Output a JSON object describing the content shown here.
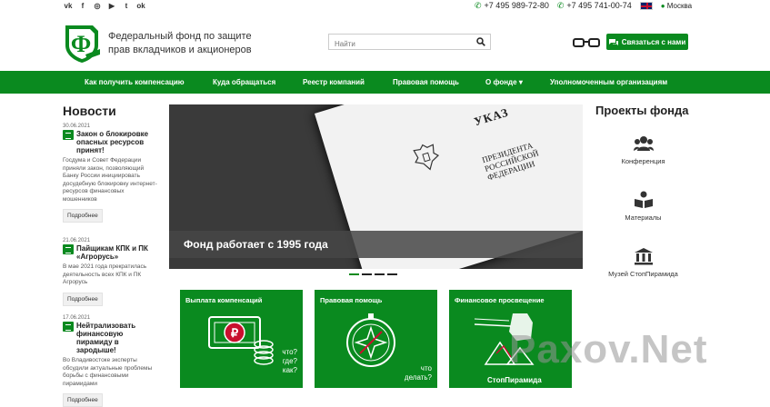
{
  "topbar": {
    "social_icons": [
      "vk-icon",
      "facebook-icon",
      "instagram-icon",
      "youtube-icon",
      "twitter-icon",
      "odnoklassniki-icon"
    ],
    "phone1": "+7 495 989-72-80",
    "phone2": "+7 495 741-00-74",
    "city": "Москва"
  },
  "header": {
    "brand_line1": "Федеральный фонд по защите",
    "brand_line2": "прав вкладчиков и акционеров",
    "search_placeholder": "Найти",
    "contact_button": "Связаться с нами",
    "accent": "#0a8a1f"
  },
  "nav": {
    "items": [
      "Как получить компенсацию",
      "Куда обращаться",
      "Реестр компаний",
      "Правовая помощь",
      "О фонде",
      "Уполномоченным организациям"
    ]
  },
  "news": {
    "heading": "Новости",
    "items": [
      {
        "date": "30.06.2021",
        "title": "Закон о блокировке опасных ресурсов принят!",
        "body": "Госдума и Совет Федерации приняли закон, позволяющий Банку России инициировать досудебную блокировку интернет-ресурсов финансовых мошенников",
        "more": "Подробнее"
      },
      {
        "date": "21.06.2021",
        "title": "Пайщикам КПК и ПК «Агрорусь»",
        "body": "В мае 2021 года прекратилась деятельность всех КПК и ПК Агрорусь",
        "more": "Подробнее"
      },
      {
        "date": "17.06.2021",
        "title": "Нейтрализовать финансовую пирамиду в зародыше!",
        "body": "Во Владивостоке эксперты обсудили актуальные проблемы борьбы с финансовыми пирамидами",
        "more": "Подробнее"
      }
    ]
  },
  "slider": {
    "caption": "Фонд работает с 1995 года",
    "decree_title": "УКАЗ",
    "decree_sub": "ПРЕЗИДЕНТА РОССИЙСКОЙ ФЕДЕРАЦИИ"
  },
  "cards": [
    {
      "label": "Выплата компенсаций",
      "text": "что? где? как?"
    },
    {
      "label": "Правовая помощь",
      "text": "что делать?"
    },
    {
      "label": "Финансовое просвещение",
      "text": "СтопПирамида"
    }
  ],
  "projects": {
    "heading": "Проекты фонда",
    "items": [
      "Конференция",
      "Материалы",
      "Музей СтопПирамида"
    ]
  },
  "watermark": "Paxov.Net"
}
